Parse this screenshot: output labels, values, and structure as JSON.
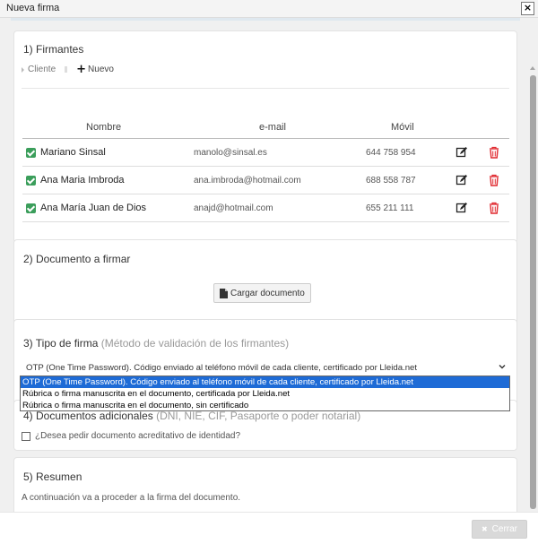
{
  "window": {
    "title": "Nueva firma",
    "close_glyph": "×"
  },
  "firmantes": {
    "title": "1) Firmantes",
    "tabs": {
      "cliente": "Cliente",
      "nuevo": "Nuevo"
    },
    "columns": {
      "name": "Nombre",
      "email": "e-mail",
      "mobile": "Móvil"
    },
    "rows": [
      {
        "name": "Mariano Sinsal",
        "email": "manolo@sinsal.es",
        "mobile": "644 758 954"
      },
      {
        "name": "Ana Maria Imbroda",
        "email": "ana.imbroda@hotmail.com",
        "mobile": "688 558 787"
      },
      {
        "name": "Ana María Juan de Dios",
        "email": "anajd@hotmail.com",
        "mobile": "655 211 111"
      }
    ]
  },
  "documento": {
    "title": "2) Documento a firmar",
    "upload_label": "Cargar documento"
  },
  "tipo": {
    "title": "3) Tipo de firma",
    "hint": "(Método de validación de los firmantes)",
    "selected": "OTP (One Time Password). Código enviado al teléfono móvil de cada cliente, certificado por Lleida.net",
    "options": [
      "OTP (One Time Password). Código enviado al teléfono móvil de cada cliente, certificado por Lleida.net",
      "Rúbrica o firma manuscrita en el documento, certificada por Lleida.net",
      "Rúbrica o firma manuscrita en el documento, sin certificado"
    ]
  },
  "adicionales": {
    "title": "4) Documentos adicionales",
    "hint": "(DNI, NIE, CIF, Pasaporte o poder notarial)",
    "checkbox_label": "¿Desea pedir documento acreditativo de identidad?"
  },
  "resumen": {
    "title": "5) Resumen",
    "text": "A continuación va a proceder a la firma del documento."
  },
  "footer": {
    "close_label": "Cerrar",
    "close_glyph": "✖"
  },
  "colors": {
    "accent_check": "#3b9e5b",
    "delete_red": "#e0282e",
    "selection_blue": "#1e6bd6"
  }
}
